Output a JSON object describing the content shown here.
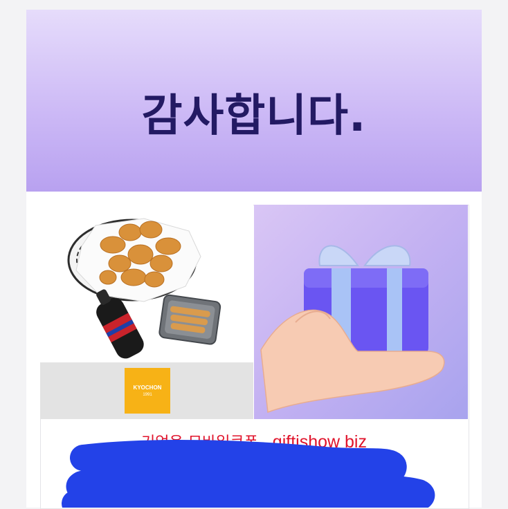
{
  "header": {
    "title": "감사합니다."
  },
  "products": [
    {
      "name": "food-photo",
      "brand_logo": {
        "line1": "KYOCHON",
        "line2": "1991"
      }
    },
    {
      "name": "gift-box-photo"
    }
  ],
  "promo": {
    "korean": "기업용 모바일쿠폰",
    "brand": "giftishow biz"
  },
  "colors": {
    "title": "#231a63",
    "promo_text": "#e0132b",
    "logo_bg": "#f7b216",
    "redaction": "#2342e8"
  }
}
